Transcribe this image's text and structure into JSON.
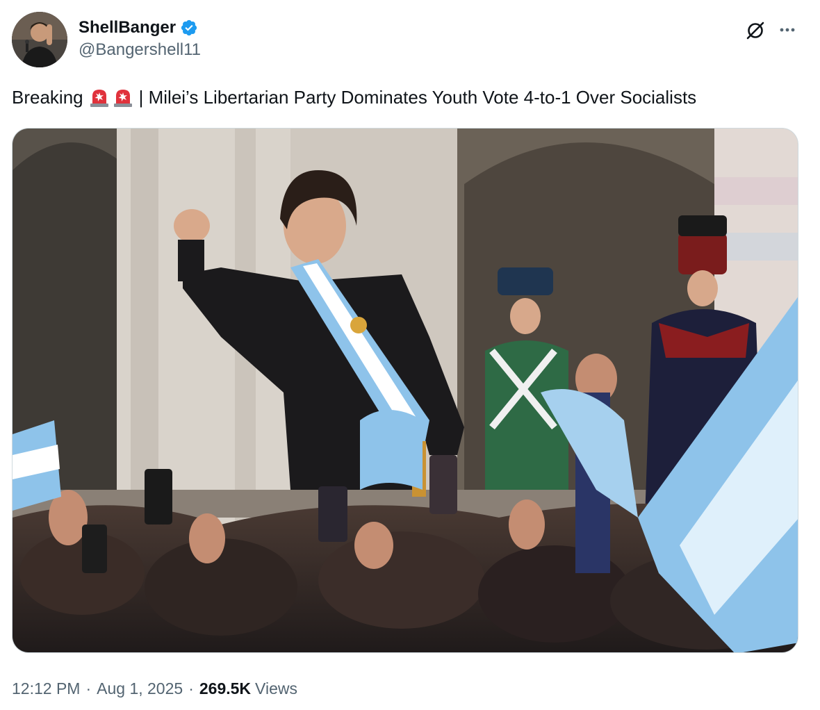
{
  "author": {
    "display_name": "ShellBanger",
    "handle": "@Bangershell11",
    "verified": true,
    "verified_color": "#1d9bf0"
  },
  "header_icons": {
    "grok": "grok-icon",
    "more": "more-icon"
  },
  "tweet": {
    "text_before": "Breaking",
    "emoji": [
      "rotating-light-emoji",
      "rotating-light-emoji"
    ],
    "text_after": "| Milei’s Libertarian Party Dominates Youth Vote 4-to-1 Over Socialists"
  },
  "media": {
    "type": "photo",
    "alt_subject": "man in suit wearing blue-white sash raising fist before crowd waving flags"
  },
  "meta": {
    "time": "12:12 PM",
    "date": "Aug 1, 2025",
    "separator": "·",
    "views_count": "269.5K",
    "views_label": "Views"
  },
  "colors": {
    "text_primary": "#0f1419",
    "text_secondary": "#536471",
    "border": "#cfd9de",
    "accent": "#1d9bf0"
  }
}
